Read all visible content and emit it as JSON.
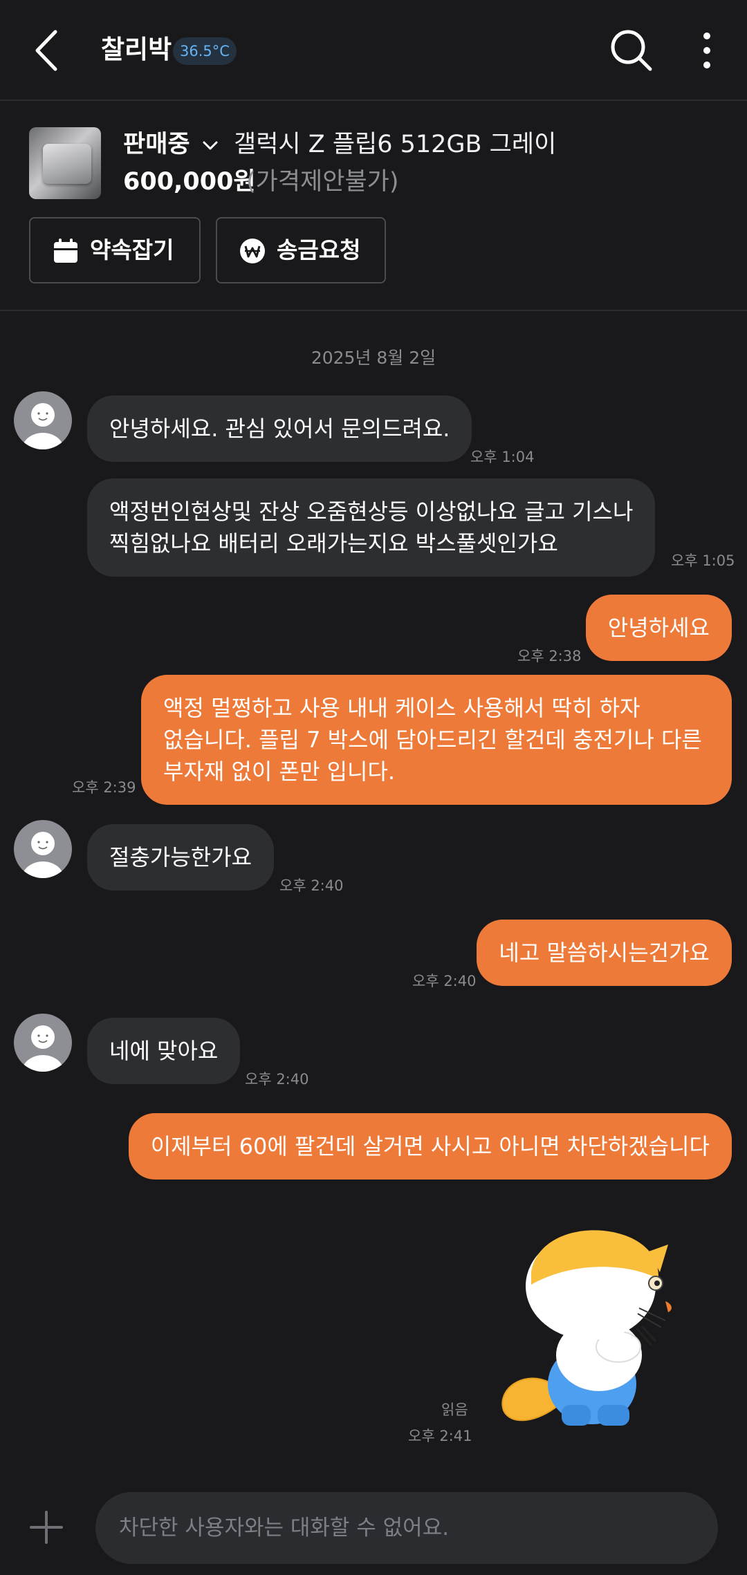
{
  "header": {
    "title": "찰리박",
    "temperature": "36.5°C"
  },
  "product": {
    "status": "판매중",
    "name": "갤럭시 Z 플립6 512GB 그레이",
    "price": "600,000원",
    "price_note": "(가격제안불가)",
    "buttons": {
      "appointment": "약속잡기",
      "transfer": "송금요청"
    }
  },
  "chat": {
    "date": "2025년 8월 2일",
    "messages": [
      {
        "side": "in",
        "lines": [
          "안녕하세요. 관심 있어서 문의드려요."
        ],
        "time": "오후 1:04"
      },
      {
        "side": "in",
        "lines": [
          "액정번인현상및 잔상 오줌현상등 이상없나요 글고 기스나",
          "찍힘없나요 배터리 오래가는지요 박스풀셋인가요"
        ],
        "time": "오후 1:05"
      },
      {
        "side": "out",
        "lines": [
          "안녕하세요"
        ],
        "time": "오후 2:38"
      },
      {
        "side": "out",
        "lines": [
          "액정 멀쩡하고 사용 내내 케이스 사용해서 딱히 하자",
          "없습니다. 플립 7 박스에 담아드리긴 할건데 충전기나  다른",
          "부자재 없이 폰만 입니다."
        ],
        "time": "오후 2:39"
      },
      {
        "side": "in",
        "lines": [
          "절충가능한가요"
        ],
        "time": "오후 2:40"
      },
      {
        "side": "out",
        "lines": [
          "네고 말씀하시는건가요"
        ],
        "time": "오후 2:40"
      },
      {
        "side": "in",
        "lines": [
          "네에 맞아요"
        ],
        "time": "오후 2:40"
      },
      {
        "side": "out",
        "lines": [
          "이제부터 60에 팔건데 살거면 사시고 아니면 차단하겠습니다"
        ],
        "time": ""
      }
    ],
    "sticker_read": "읽음",
    "sticker_time": "오후 2:41"
  },
  "input": {
    "placeholder": "차단한 사용자와는 대화할 수 없어요."
  },
  "colors": {
    "background": "#19191b",
    "outgoing_bubble": "#ee7a39",
    "incoming_bubble": "#2d2e31",
    "temperature": "#64b4f6"
  },
  "icons": [
    "back-arrow-icon",
    "search-icon",
    "more-vertical-icon",
    "chevron-down-icon",
    "calendar-icon",
    "won-icon",
    "avatar-icon",
    "plus-icon"
  ]
}
